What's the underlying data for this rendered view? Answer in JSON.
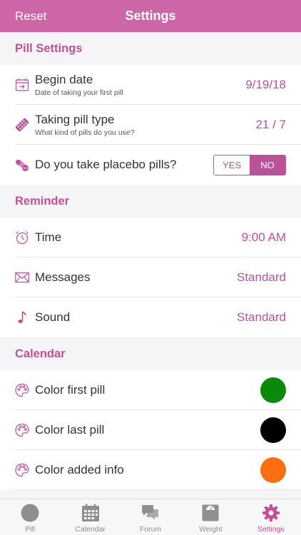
{
  "nav": {
    "left_label": "Reset",
    "title": "Settings"
  },
  "pill_settings": {
    "header": "Pill Settings",
    "begin_date": {
      "title": "Begin date",
      "subtitle": "Date of taking your first pill",
      "value": "9/19/18",
      "icon": "calendar-arrow-icon"
    },
    "pill_type": {
      "title": "Taking pill type",
      "subtitle": "What kind of pills do you use?",
      "value": "21 / 7",
      "icon": "pill-pack-icon"
    },
    "placebo": {
      "title": "Do you take placebo pills?",
      "yes_label": "YES",
      "no_label": "NO",
      "selected": "NO",
      "icon": "pills-icon"
    }
  },
  "reminder": {
    "header": "Reminder",
    "time": {
      "title": "Time",
      "value": "9:00 AM",
      "icon": "alarm-clock-icon"
    },
    "messages": {
      "title": "Messages",
      "value": "Standard",
      "icon": "envelope-icon"
    },
    "sound": {
      "title": "Sound",
      "value": "Standard",
      "icon": "music-note-icon"
    }
  },
  "calendar": {
    "header": "Calendar",
    "first_pill": {
      "title": "Color first pill",
      "color": "#0a8a0a",
      "icon": "palette-icon"
    },
    "last_pill": {
      "title": "Color last pill",
      "color": "#000000",
      "icon": "palette-icon"
    },
    "added_info": {
      "title": "Color added info",
      "color": "#fb6f0e",
      "icon": "palette-icon"
    }
  },
  "tabs": [
    {
      "label": "Pill",
      "icon": "pill-circle-icon",
      "active": false
    },
    {
      "label": "Calendar",
      "icon": "calendar-icon",
      "active": false
    },
    {
      "label": "Forum",
      "icon": "chat-bubbles-icon",
      "active": false
    },
    {
      "label": "Weight",
      "icon": "scale-icon",
      "active": false
    },
    {
      "label": "Settings",
      "icon": "gear-icon",
      "active": true
    }
  ],
  "colors": {
    "accent": "#c24f98",
    "navbar": "#cd66a6",
    "tab_inactive": "#8e8e93"
  }
}
